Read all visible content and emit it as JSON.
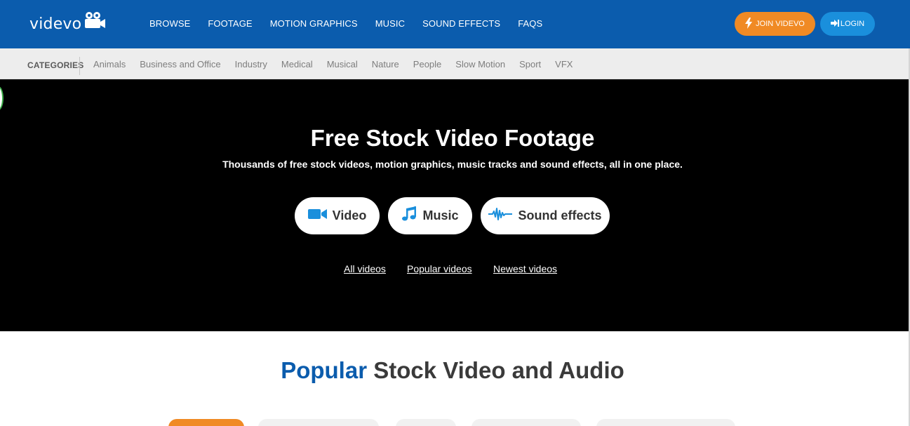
{
  "header": {
    "logo_text": "videvo",
    "nav": [
      "BROWSE",
      "FOOTAGE",
      "MOTION GRAPHICS",
      "MUSIC",
      "SOUND EFFECTS",
      "FAQS"
    ],
    "join_label": "JOIN VIDEVO",
    "login_label": "LOGIN"
  },
  "categories": {
    "label": "CATEGORIES",
    "items": [
      "Animals",
      "Business and Office",
      "Industry",
      "Medical",
      "Musical",
      "Nature",
      "People",
      "Slow Motion",
      "Sport",
      "VFX"
    ]
  },
  "hero": {
    "title": "Free Stock Video Footage",
    "subtitle": "Thousands of free stock videos, motion graphics, music tracks and sound effects, all in one place.",
    "buttons": {
      "video": "Video",
      "music": "Music",
      "sound_effects": "Sound effects"
    },
    "links": {
      "all_videos": "All videos",
      "popular_videos": "Popular videos",
      "newest_videos": "Newest videos"
    }
  },
  "popular": {
    "accent": "Popular",
    "rest": "Stock Video and Audio"
  },
  "colors": {
    "header_blue": "#0b5cad",
    "join_orange": "#f08a24",
    "login_blue": "#1a8fdc",
    "icon_blue": "#1a8fdc"
  },
  "icons": [
    "camera-icon",
    "bolt-icon",
    "login-icon",
    "video-camera-icon",
    "music-note-icon",
    "waveform-icon"
  ]
}
